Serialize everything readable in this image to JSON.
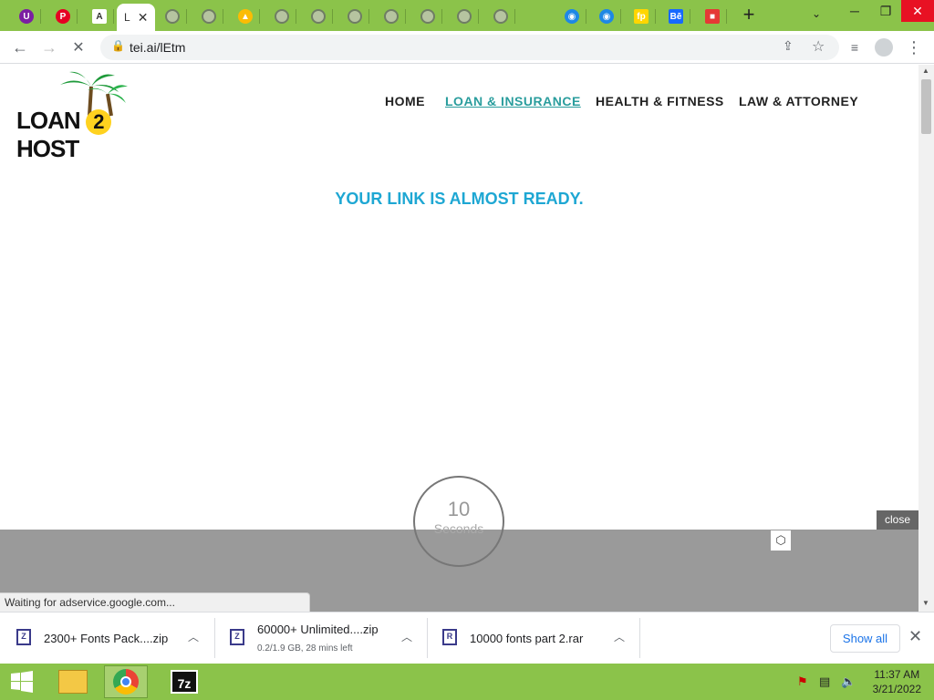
{
  "browser": {
    "tabs": [
      {
        "name": "ublock-tab",
        "glyph": "U",
        "bg": "#7b1fa2"
      },
      {
        "name": "pinterest-tab",
        "glyph": "P",
        "bg": "#e60023"
      },
      {
        "name": "audio-tab",
        "glyph": "A",
        "bg": "#ffffff"
      },
      {
        "name": "globe-tab-1",
        "glyph": "",
        "bg": "globe"
      },
      {
        "name": "globe-tab-2",
        "glyph": "",
        "bg": "globe"
      },
      {
        "name": "drive-tab",
        "glyph": "▲",
        "bg": "#fbbc04"
      },
      {
        "name": "globe-tab-3",
        "glyph": "",
        "bg": "globe"
      },
      {
        "name": "globe-tab-4",
        "glyph": "",
        "bg": "globe"
      },
      {
        "name": "globe-tab-5",
        "glyph": "",
        "bg": "globe"
      },
      {
        "name": "globe-tab-6",
        "glyph": "",
        "bg": "globe"
      },
      {
        "name": "globe-tab-7",
        "glyph": "",
        "bg": "globe"
      },
      {
        "name": "globe-tab-8",
        "glyph": "",
        "bg": "globe"
      },
      {
        "name": "globe-tab-9",
        "glyph": "",
        "bg": "globe"
      },
      {
        "name": "cloud-tab-1",
        "glyph": "◉",
        "bg": "#1e88e5"
      },
      {
        "name": "cloud-tab-2",
        "glyph": "◉",
        "bg": "#1e88e5"
      },
      {
        "name": "fp-tab",
        "glyph": "fp",
        "bg": "#ffd600"
      },
      {
        "name": "behance-tab",
        "glyph": "Bē",
        "bg": "#1769ff"
      },
      {
        "name": "colorful-tab",
        "glyph": "■",
        "bg": "#e53935"
      }
    ],
    "active_tab_glyph": "L",
    "audio_tab_label": "A",
    "new_tab": "+",
    "address": "tei.ai/lEtm"
  },
  "site": {
    "logo_text_left": "LOAN",
    "logo_text_num": "2",
    "logo_text_right": "HOST",
    "nav": [
      "HOME",
      "LOAN & INSURANCE",
      "HEALTH & FITNESS",
      "LAW & ATTORNEY"
    ],
    "heading": "YOUR LINK IS ALMOST READY.",
    "countdown_number": "10",
    "countdown_label": "Seconds",
    "ad_close": "close",
    "status": "Waiting for adservice.google.com..."
  },
  "downloads": {
    "items": [
      {
        "name": "2300+ Fonts Pack....zip",
        "sub": "",
        "icon": "Z"
      },
      {
        "name": "60000+ Unlimited....zip",
        "sub": "0.2/1.9 GB, 28 mins left",
        "icon": "Z"
      },
      {
        "name": "10000 fonts part 2.rar",
        "sub": "",
        "icon": "R"
      }
    ],
    "show_all": "Show all"
  },
  "taskbar": {
    "time": "11:37 AM",
    "date": "3/21/2022"
  },
  "colors": {
    "chrome_green": "#8bc34a",
    "heading_blue": "#1ea7d3",
    "active_nav": "#2a9d9d"
  }
}
